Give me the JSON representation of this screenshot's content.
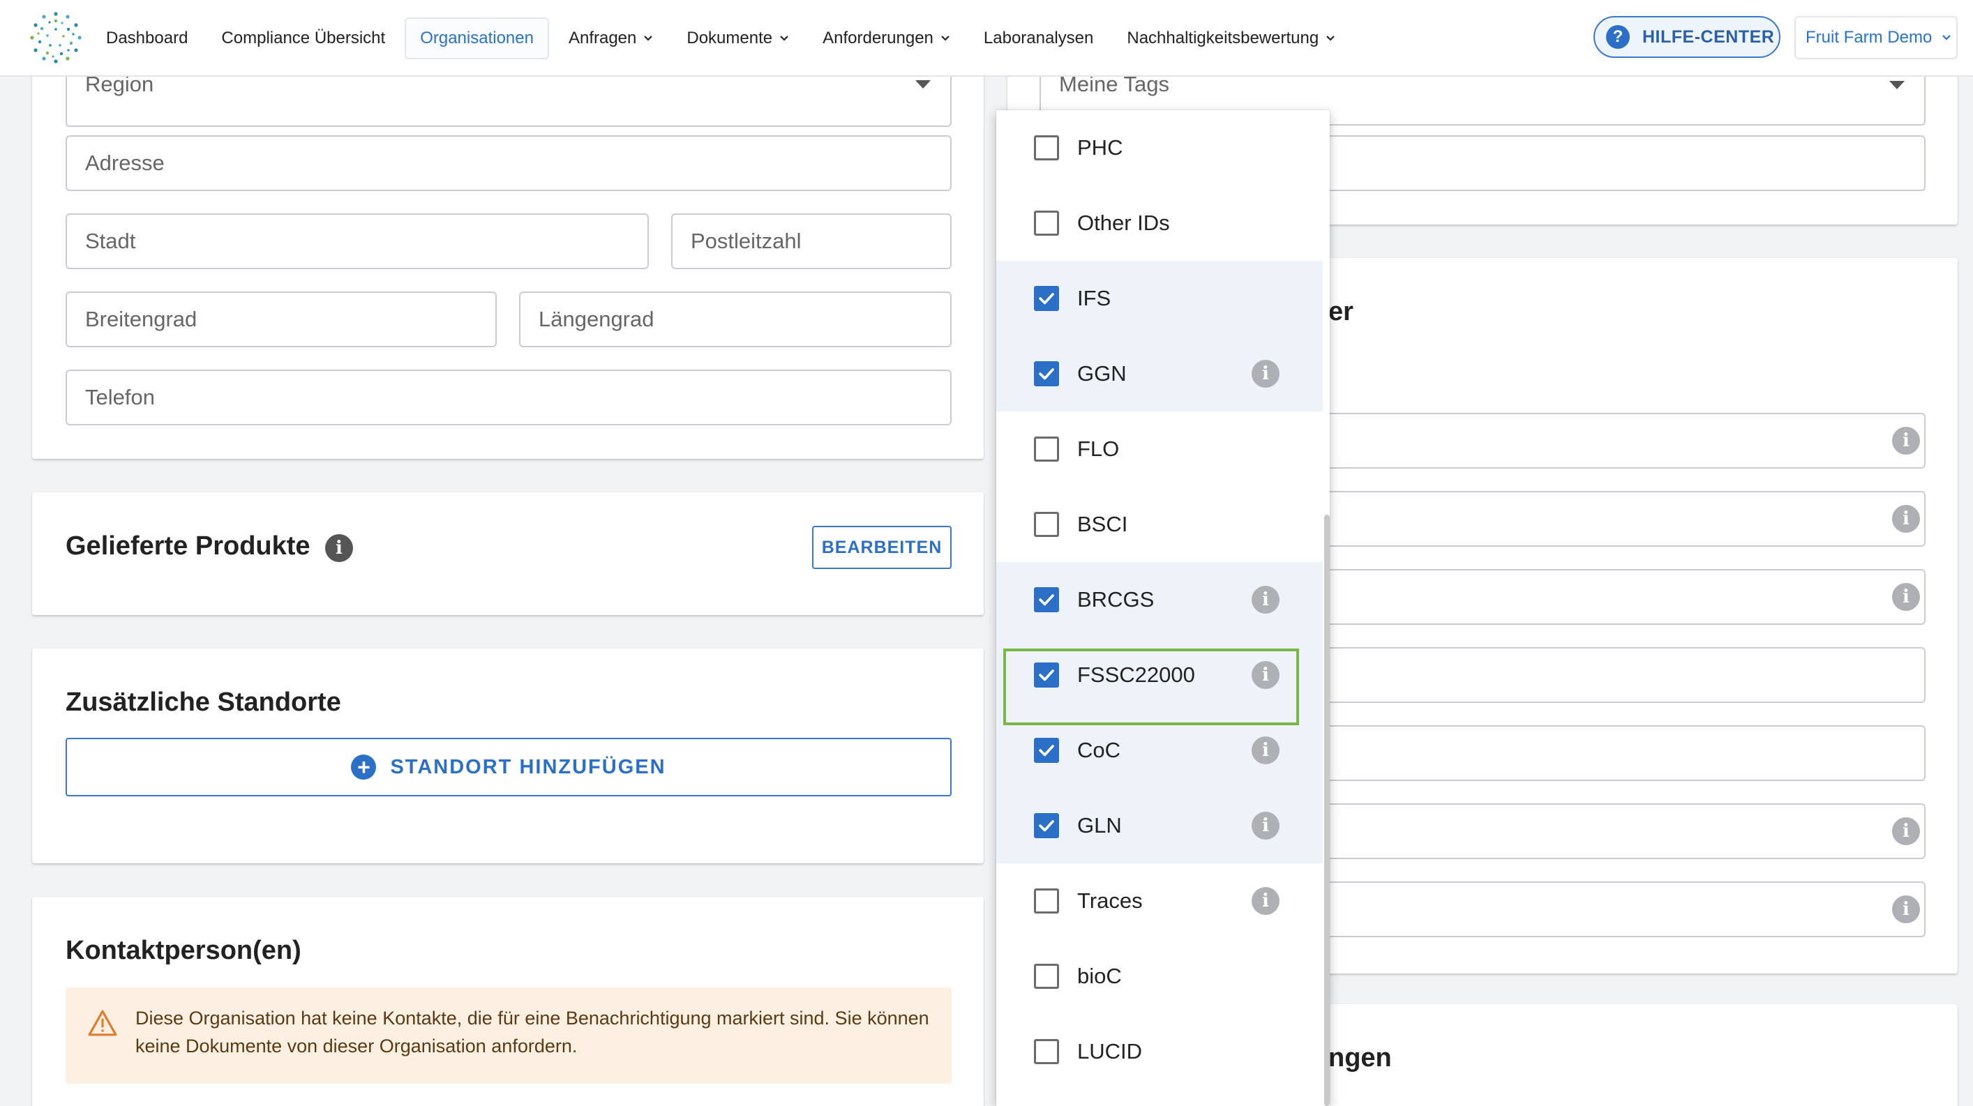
{
  "nav": {
    "items": [
      {
        "label": "Dashboard",
        "dropdown": false,
        "active": false
      },
      {
        "label": "Compliance Übersicht",
        "dropdown": false,
        "active": false
      },
      {
        "label": "Organisationen",
        "dropdown": false,
        "active": true
      },
      {
        "label": "Anfragen",
        "dropdown": true,
        "active": false
      },
      {
        "label": "Dokumente",
        "dropdown": true,
        "active": false
      },
      {
        "label": "Anforderungen",
        "dropdown": true,
        "active": false
      },
      {
        "label": "Laboranalysen",
        "dropdown": false,
        "active": false
      },
      {
        "label": "Nachhaltigkeitsbewertung",
        "dropdown": true,
        "active": false
      }
    ],
    "help_label": "HILFE-CENTER",
    "org_label": "Fruit Farm Demo"
  },
  "address_card": {
    "region_placeholder": "Region",
    "address_placeholder": "Adresse",
    "city_placeholder": "Stadt",
    "zip_placeholder": "Postleitzahl",
    "lat_placeholder": "Breitengrad",
    "lng_placeholder": "Längengrad",
    "phone_placeholder": "Telefon"
  },
  "products_card": {
    "title": "Gelieferte Produkte",
    "edit_label": "BEARBEITEN"
  },
  "locations_card": {
    "title": "Zusätzliche Standorte",
    "add_label": "STANDORT HINZUFÜGEN"
  },
  "contacts_card": {
    "title": "Kontaktperson(en)",
    "warning": "Diese Organisation hat keine Kontakte, die für eine Benachrichtigung markiert sind. Sie können keine Dokumente von dieser Organisation anfordern."
  },
  "right_panel": {
    "tags_placeholder": "Meine Tags",
    "partial_title_1": "er",
    "partial_title_2": "ngen"
  },
  "id_options": [
    {
      "label": "PHC",
      "checked": false,
      "info": false
    },
    {
      "label": "Other IDs",
      "checked": false,
      "info": false
    },
    {
      "label": "IFS",
      "checked": true,
      "info": false
    },
    {
      "label": "GGN",
      "checked": true,
      "info": true
    },
    {
      "label": "FLO",
      "checked": false,
      "info": false
    },
    {
      "label": "BSCI",
      "checked": false,
      "info": false
    },
    {
      "label": "BRCGS",
      "checked": true,
      "info": true
    },
    {
      "label": "FSSC22000",
      "checked": true,
      "info": true
    },
    {
      "label": "CoC",
      "checked": true,
      "info": true
    },
    {
      "label": "GLN",
      "checked": true,
      "info": true
    },
    {
      "label": "Traces",
      "checked": false,
      "info": true
    },
    {
      "label": "bioC",
      "checked": false,
      "info": false
    },
    {
      "label": "LUCID",
      "checked": false,
      "info": false
    }
  ],
  "colors": {
    "accent": "#2b6fc7",
    "highlight": "#7ab648",
    "warning_bg": "#fdf0e3",
    "warning_icon": "#e07b2a"
  }
}
